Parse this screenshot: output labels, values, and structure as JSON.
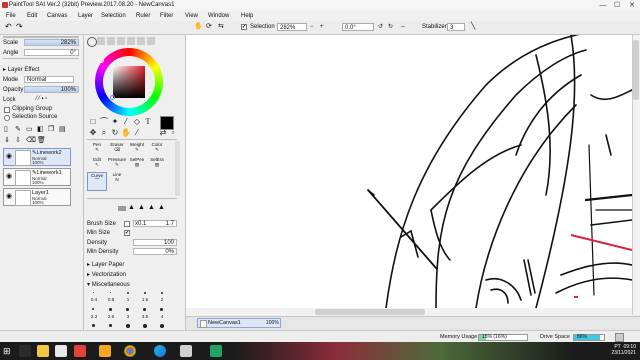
{
  "window": {
    "title": "PaintTool SAI Ver.2 (32bit) Preview.2017.08.20 - NewCanvas1",
    "minimize": "—",
    "maximize": "☐",
    "close": "✕"
  },
  "menu": [
    "File",
    "Edit",
    "Canvas",
    "Layer",
    "Selection",
    "Ruler",
    "Filter",
    "View",
    "Window",
    "Help"
  ],
  "toolbar": {
    "selection_label": "Selection",
    "zoom_value": "282%",
    "angle_value": "0.0°",
    "stabilizer_label": "Stabilizer",
    "stabilizer_value": "3"
  },
  "nav": {
    "scale_label": "Scale",
    "scale_value": "282%",
    "angle_label": "Angle",
    "angle_value": "0°"
  },
  "layer_effect": {
    "header": "Layer Effect",
    "mode_label": "Mode",
    "mode_value": "Normal",
    "opacity_label": "Opacity",
    "opacity_value": "100%",
    "lock_label": "Lock",
    "clipping_label": "Clipping Group",
    "selection_source_label": "Selection Source"
  },
  "layers": [
    {
      "name": "Linework2",
      "mode": "Normal",
      "opacity": "100%",
      "selected": true
    },
    {
      "name": "Linework1",
      "mode": "Normal",
      "opacity": "100%",
      "selected": false
    },
    {
      "name": "Layer1",
      "mode": "Normal",
      "opacity": "100%",
      "selected": false
    }
  ],
  "brushes": {
    "row1": [
      "Pen",
      "Eraser",
      "Weight",
      "Color"
    ],
    "row2": [
      "Edit",
      "Pressure",
      "SelPen",
      "SelEra"
    ],
    "row3": [
      "Curve",
      "Line"
    ]
  },
  "brush_settings": {
    "brush_size_label": "Brush Size",
    "brush_size_mult": "x0.1",
    "brush_size_value": "1.7",
    "min_size_label": "Min Size",
    "density_label": "Density",
    "density_value": "100",
    "min_density_label": "Min Density",
    "min_density_value": "0%",
    "layer_paper": "Layer Paper",
    "vectorization": "Vectorization",
    "miscellaneous": "Miscellaneous",
    "size_row1": [
      "0.4",
      "0.8",
      "1",
      "1.6",
      "2"
    ],
    "size_row2": [
      "2.3",
      "2.6",
      "3",
      "3.5",
      "4"
    ]
  },
  "document": {
    "name": "NewCanvas1",
    "zoom": "100%"
  },
  "status": {
    "memory_label": "Memory Usage",
    "memory_value": "15% (16%)",
    "memory_fraction": 0.15,
    "drive_label": "Drive Space",
    "drive_value": "86%",
    "drive_fraction": 0.86
  },
  "taskbar": {
    "clock_time": "09:10",
    "clock_date": "23/11/2021",
    "lang": "PT"
  },
  "colors": {
    "accent_blue": "#7a98c9",
    "selected_color": "#000000",
    "picker_hue": "#e0222b",
    "red_stroke": "#e02040"
  }
}
